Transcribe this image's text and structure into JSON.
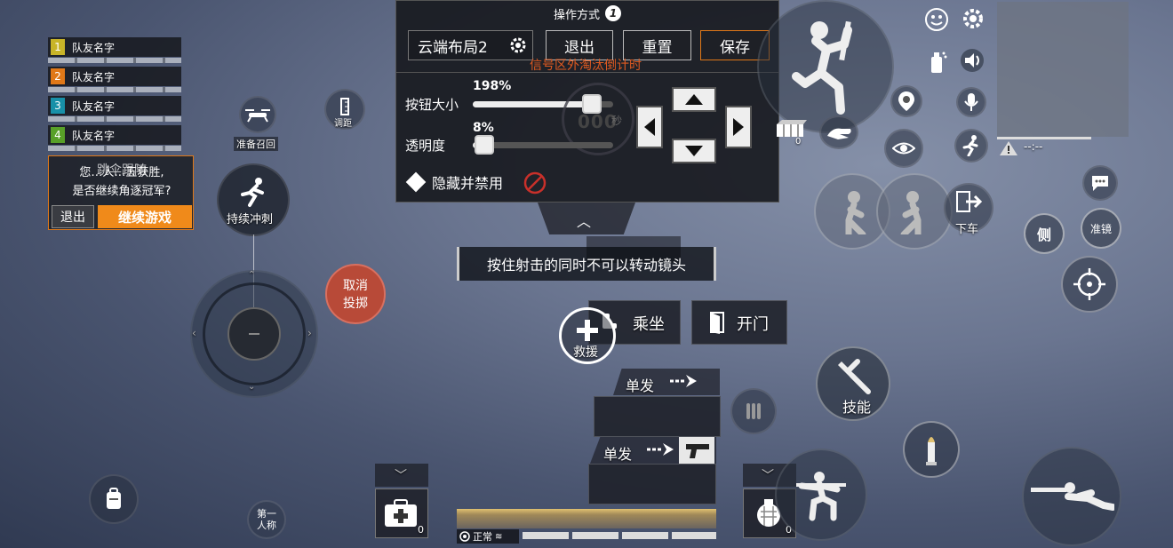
{
  "team": {
    "members": [
      {
        "num": "1",
        "name": "队友名字",
        "color": "#c8b428"
      },
      {
        "num": "2",
        "name": "队友名字",
        "color": "#e07818"
      },
      {
        "num": "3",
        "name": "队友名字",
        "color": "#1890a8"
      },
      {
        "num": "4",
        "name": "队友名字",
        "color": "#58a028"
      }
    ]
  },
  "popup": {
    "line_overlay": "跳伞跟随",
    "line1": "您…人…五获胜,",
    "line2": "是否继续角逐冠军?",
    "exit_label": "退出",
    "continue_label": "继续游戏"
  },
  "layout_panel": {
    "title": "操作方式",
    "title_badge": "1",
    "scheme_name": "云端布局2",
    "exit_label": "退出",
    "reset_label": "重置",
    "save_label": "保存",
    "signal_text": "信号区外淘汰倒计时",
    "size_label": "按钮大小",
    "size_value": "198%",
    "size_fraction": 0.85,
    "opacity_label": "透明度",
    "opacity_value": "8%",
    "opacity_fraction": 0.08,
    "hide_label": "隐藏并禁用",
    "timer_digits": "000",
    "timer_unit": "秒"
  },
  "left_controls": {
    "drone_label": "准备召回",
    "adjust_label": "调距",
    "sprint_label": "持续冲刺",
    "cancel_throw_line1": "取消",
    "cancel_throw_line2": "投掷",
    "first_person_line1": "第一",
    "first_person_line2": "人称"
  },
  "center": {
    "tooltip": "按住射击的同时不可以转动镜头",
    "ride_label": "乘坐",
    "door_label": "开门",
    "rescue_label": "救援",
    "fire_mode_1": "单发",
    "fire_mode_2": "单发",
    "medkit_count": "0",
    "grenade_count": "0",
    "status_label": "正常"
  },
  "right_controls": {
    "skill_label": "技能",
    "exit_vehicle_label": "下车",
    "side_label": "侧",
    "scope_label": "准镜",
    "ammo_box_count": "0",
    "minimap_text": "--:--"
  },
  "colors": {
    "save_border": "#e07818",
    "cancel_throw_bg": "#b84a38",
    "continue_bg": "#f08a1a",
    "signal_text": "#e05a20"
  }
}
